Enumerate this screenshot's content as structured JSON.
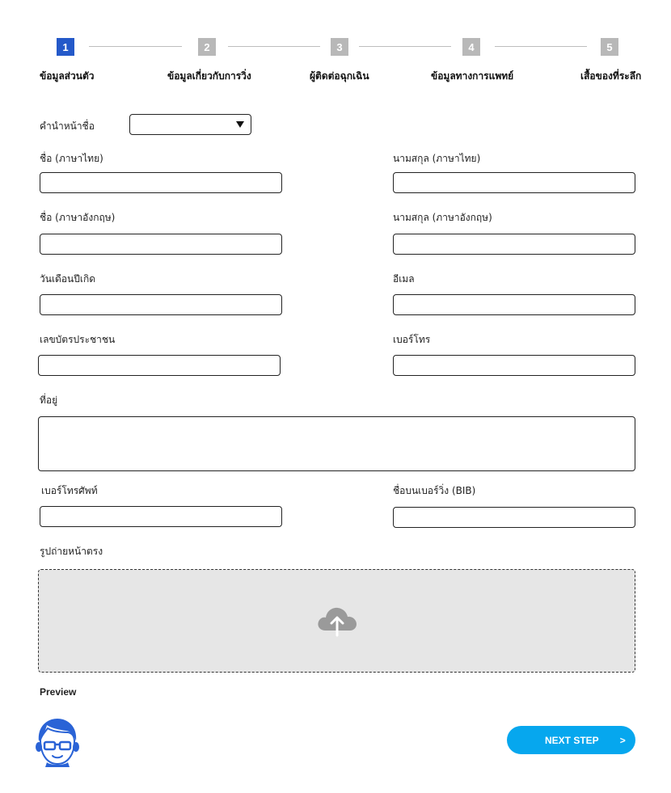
{
  "stepper": {
    "steps": [
      {
        "number": "1",
        "label": "ข้อมูลส่วนตัว",
        "active": true
      },
      {
        "number": "2",
        "label": "ข้อมูลเกี่ยวกับการวิ่ง",
        "active": false
      },
      {
        "number": "3",
        "label": "ผู้ติดต่อฉุกเฉิน",
        "active": false
      },
      {
        "number": "4",
        "label": "ข้อมูลทางการแพทย์",
        "active": false
      },
      {
        "number": "5",
        "label": "เสื้อของที่ระลึก",
        "active": false
      }
    ],
    "active_color": "#2459c9",
    "inactive_color": "#b8b8b8"
  },
  "form": {
    "title_prefix": {
      "label": "คำนำหน้าชื่อ",
      "value": ""
    },
    "first_name_th": {
      "label": "ชื่อ (ภาษาไทย)",
      "value": ""
    },
    "last_name_th": {
      "label": "นามสกุล (ภาษาไทย)",
      "value": ""
    },
    "first_name_en": {
      "label": "ชื่อ (ภาษาอังกฤษ)",
      "value": ""
    },
    "last_name_en": {
      "label": "นามสกุล (ภาษาอังกฤษ)",
      "value": ""
    },
    "birth_date": {
      "label": "วันเดือนปีเกิด",
      "value": ""
    },
    "email": {
      "label": "อีเมล",
      "value": ""
    },
    "id_card": {
      "label": "เลขบัตรประชาชน",
      "value": ""
    },
    "phone": {
      "label": "เบอร์โทร",
      "value": ""
    },
    "address": {
      "label": "ที่อยู่",
      "value": ""
    },
    "telephone": {
      "label": "เบอร์โทรศัพท์",
      "value": ""
    },
    "bib_name": {
      "label": "ชื่อบนเบอร์วิ่ง (BIB)",
      "value": ""
    },
    "photo": {
      "label": "รูปถ่ายหน้าตรง",
      "upload_icon": "cloud-upload-icon"
    },
    "preview": {
      "label": "Preview",
      "avatar_icon": "user-avatar-icon"
    }
  },
  "actions": {
    "next_label": "NEXT STEP",
    "next_arrow": ">",
    "button_color": "#06a7ee"
  }
}
